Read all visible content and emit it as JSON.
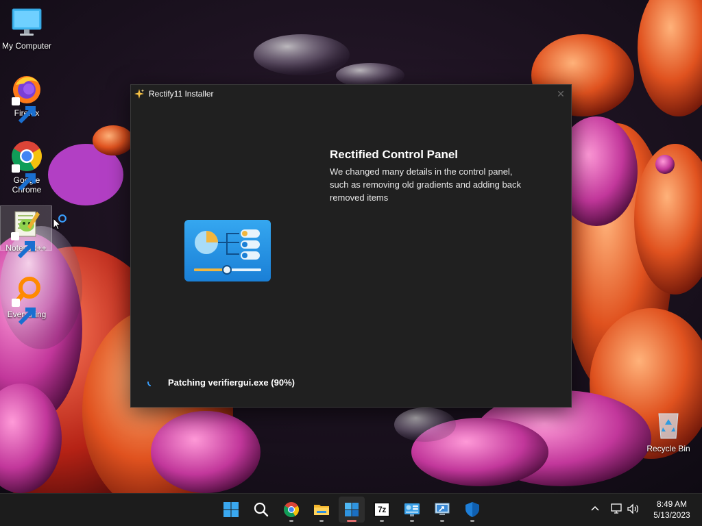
{
  "desktop": {
    "icons": [
      {
        "label": "My Computer",
        "icon": "monitor-icon"
      },
      {
        "label": "Firefox",
        "icon": "firefox-icon"
      },
      {
        "label": "Google Chrome",
        "icon": "chrome-icon"
      },
      {
        "label": "Notepad++",
        "icon": "notepadpp-icon"
      },
      {
        "label": "Everything",
        "icon": "everything-search-icon"
      },
      {
        "label": "Recycle Bin",
        "icon": "recycle-bin-icon"
      }
    ]
  },
  "installer": {
    "title": "Rectify11 Installer",
    "close_glyph": "✕",
    "feature_title": "Rectified Control Panel",
    "feature_description": "We changed many details in the control panel, such as removing old gradients and adding back removed items",
    "status": "Patching verifiergui.exe (90%)",
    "progress_percent": 90
  },
  "taskbar": {
    "items": [
      {
        "name": "start",
        "icon": "windows-logo-icon"
      },
      {
        "name": "search",
        "icon": "search-icon"
      },
      {
        "name": "chrome",
        "icon": "chrome-icon"
      },
      {
        "name": "file-explorer",
        "icon": "folder-icon"
      },
      {
        "name": "rectify11-installer",
        "icon": "installer-icon",
        "active": true
      },
      {
        "name": "7zip",
        "icon": "7zip-icon",
        "text": "7z"
      },
      {
        "name": "control-panel",
        "icon": "control-panel-icon"
      },
      {
        "name": "remote-desktop",
        "icon": "remote-desktop-icon"
      },
      {
        "name": "windows-security",
        "icon": "shield-icon"
      }
    ],
    "tray": {
      "time": "8:49 AM",
      "date": "5/13/2023"
    }
  },
  "colors": {
    "accent": "#0078d4",
    "dialog_bg": "#202020",
    "taskbar_bg": "#1c1c1c"
  }
}
